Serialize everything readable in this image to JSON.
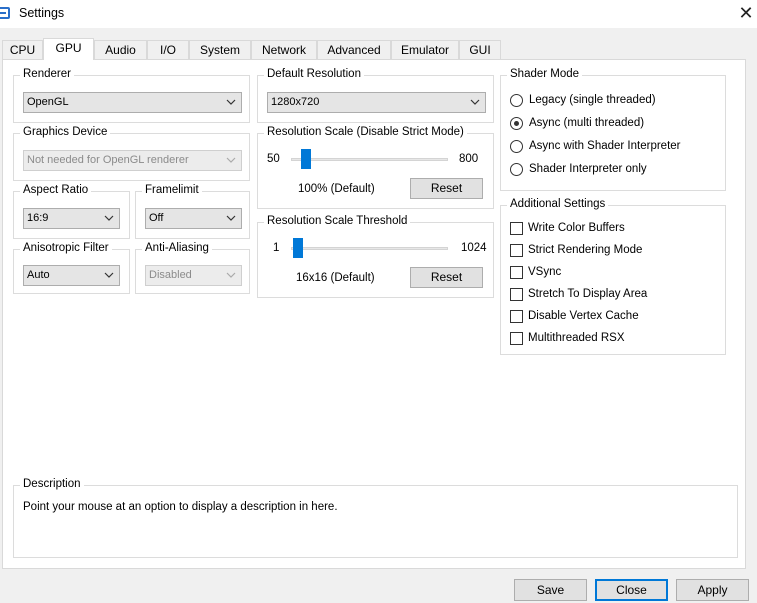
{
  "window": {
    "title": "Settings"
  },
  "tabs": [
    {
      "label": "CPU"
    },
    {
      "label": "GPU"
    },
    {
      "label": "Audio"
    },
    {
      "label": "I/O"
    },
    {
      "label": "System"
    },
    {
      "label": "Network"
    },
    {
      "label": "Advanced"
    },
    {
      "label": "Emulator"
    },
    {
      "label": "GUI"
    }
  ],
  "active_tab": "GPU",
  "renderer": {
    "title": "Renderer",
    "value": "OpenGL"
  },
  "graphics_device": {
    "title": "Graphics Device",
    "value": "Not needed for OpenGL renderer",
    "disabled": true
  },
  "aspect_ratio": {
    "title": "Aspect Ratio",
    "value": "16:9"
  },
  "framelimit": {
    "title": "Framelimit",
    "value": "Off"
  },
  "anisotropic": {
    "title": "Anisotropic Filter",
    "value": "Auto"
  },
  "anti_aliasing": {
    "title": "Anti-Aliasing",
    "value": "Disabled",
    "disabled": true
  },
  "default_resolution": {
    "title": "Default Resolution",
    "value": "1280x720"
  },
  "resolution_scale": {
    "title": "Resolution Scale (Disable Strict Mode)",
    "min": "50",
    "max": "800",
    "value": 100,
    "value_label": "100% (Default)",
    "reset": "Reset"
  },
  "resolution_threshold": {
    "title": "Resolution Scale Threshold",
    "min": "1",
    "max": "1024",
    "value_label": "16x16 (Default)",
    "reset": "Reset"
  },
  "shader_mode": {
    "title": "Shader Mode",
    "options": [
      {
        "label": "Legacy (single threaded)",
        "selected": false
      },
      {
        "label": "Async (multi threaded)",
        "selected": true
      },
      {
        "label": "Async with Shader Interpreter",
        "selected": false
      },
      {
        "label": "Shader Interpreter only",
        "selected": false
      }
    ]
  },
  "additional_settings": {
    "title": "Additional Settings",
    "options": [
      {
        "label": "Write Color Buffers",
        "checked": false
      },
      {
        "label": "Strict Rendering Mode",
        "checked": false
      },
      {
        "label": "VSync",
        "checked": false
      },
      {
        "label": "Stretch To Display Area",
        "checked": false
      },
      {
        "label": "Disable Vertex Cache",
        "checked": false
      },
      {
        "label": "Multithreaded RSX",
        "checked": false
      }
    ]
  },
  "description": {
    "title": "Description",
    "text": "Point your mouse at an option to display a description in here."
  },
  "footer": {
    "save": "Save",
    "close": "Close",
    "apply": "Apply"
  },
  "icons": {
    "app": "rpcs3-app-icon",
    "close": "close-icon",
    "dropdown": "chevron-down-icon"
  }
}
